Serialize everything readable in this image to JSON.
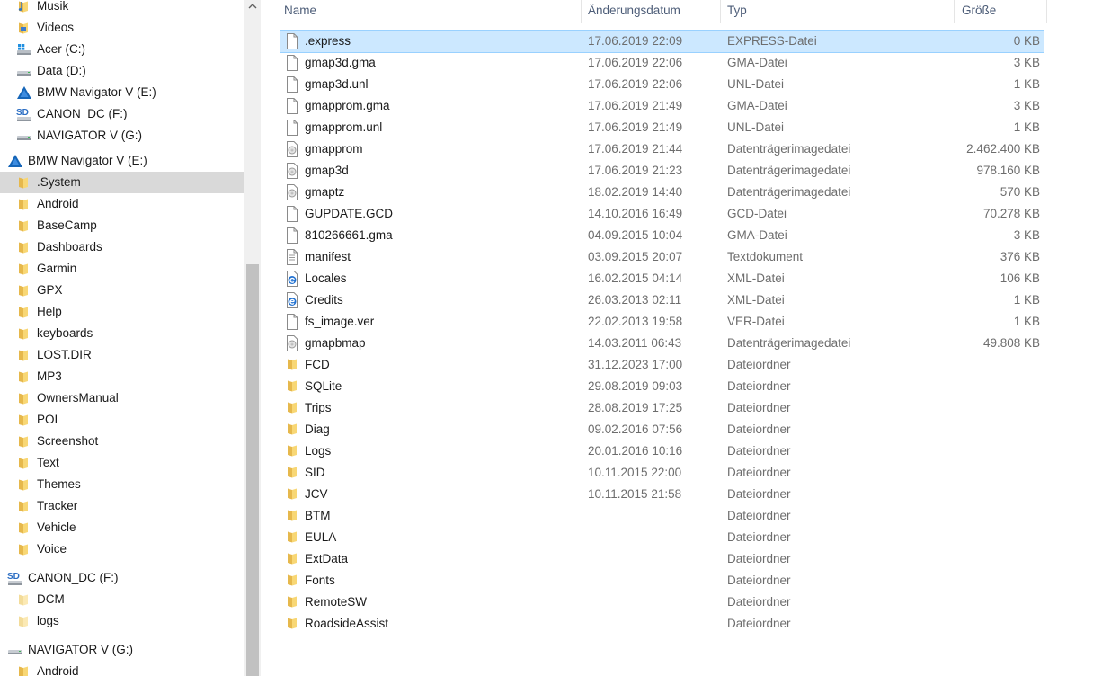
{
  "nav": {
    "items": [
      {
        "label": "Musik",
        "icon": "music-icon",
        "indent": 1
      },
      {
        "label": "Videos",
        "icon": "video-icon",
        "indent": 1
      },
      {
        "label": "Acer (C:)",
        "icon": "drive-windows-icon",
        "indent": 1
      },
      {
        "label": "Data (D:)",
        "icon": "drive-icon",
        "indent": 1
      },
      {
        "label": "BMW Navigator V (E:)",
        "icon": "bmw-drive-icon",
        "indent": 1
      },
      {
        "label": "CANON_DC (F:)",
        "icon": "sd-card-icon",
        "indent": 1
      },
      {
        "label": "NAVIGATOR V (G:)",
        "icon": "drive-icon",
        "indent": 1
      },
      {
        "label": "BMW Navigator V (E:)",
        "icon": "bmw-drive-icon",
        "indent": 0
      },
      {
        "label": ".System",
        "icon": "folder-icon",
        "indent": 1,
        "selected": true
      },
      {
        "label": "Android",
        "icon": "folder-icon",
        "indent": 1
      },
      {
        "label": "BaseCamp",
        "icon": "folder-icon",
        "indent": 1
      },
      {
        "label": "Dashboards",
        "icon": "folder-icon",
        "indent": 1
      },
      {
        "label": "Garmin",
        "icon": "folder-icon",
        "indent": 1
      },
      {
        "label": "GPX",
        "icon": "folder-icon",
        "indent": 1
      },
      {
        "label": "Help",
        "icon": "folder-icon",
        "indent": 1
      },
      {
        "label": "keyboards",
        "icon": "folder-icon",
        "indent": 1
      },
      {
        "label": "LOST.DIR",
        "icon": "folder-icon",
        "indent": 1
      },
      {
        "label": "MP3",
        "icon": "folder-icon",
        "indent": 1
      },
      {
        "label": "OwnersManual",
        "icon": "folder-icon",
        "indent": 1
      },
      {
        "label": "POI",
        "icon": "folder-icon",
        "indent": 1
      },
      {
        "label": "Screenshot",
        "icon": "folder-icon",
        "indent": 1
      },
      {
        "label": "Text",
        "icon": "folder-icon",
        "indent": 1
      },
      {
        "label": "Themes",
        "icon": "folder-icon",
        "indent": 1
      },
      {
        "label": "Tracker",
        "icon": "folder-icon",
        "indent": 1
      },
      {
        "label": "Vehicle",
        "icon": "folder-icon",
        "indent": 1
      },
      {
        "label": "Voice",
        "icon": "folder-icon",
        "indent": 1
      },
      {
        "label": "CANON_DC (F:)",
        "icon": "sd-card-icon",
        "indent": 0
      },
      {
        "label": "DCM",
        "icon": "folder-light-icon",
        "indent": 1
      },
      {
        "label": "logs",
        "icon": "folder-light-icon",
        "indent": 1
      },
      {
        "label": "NAVIGATOR V (G:)",
        "icon": "drive-icon",
        "indent": 0
      },
      {
        "label": "Android",
        "icon": "folder-icon",
        "indent": 1
      }
    ]
  },
  "columns": {
    "name": "Name",
    "date": "Änderungsdatum",
    "type": "Typ",
    "size": "Größe"
  },
  "files": [
    {
      "name": ".express",
      "date": "17.06.2019 22:09",
      "type": "EXPRESS-Datei",
      "size": "0 KB",
      "icon": "file-icon",
      "selected": true
    },
    {
      "name": "gmap3d.gma",
      "date": "17.06.2019 22:06",
      "type": "GMA-Datei",
      "size": "3 KB",
      "icon": "file-icon"
    },
    {
      "name": "gmap3d.unl",
      "date": "17.06.2019 22:06",
      "type": "UNL-Datei",
      "size": "1 KB",
      "icon": "file-icon"
    },
    {
      "name": "gmapprom.gma",
      "date": "17.06.2019 21:49",
      "type": "GMA-Datei",
      "size": "3 KB",
      "icon": "file-icon"
    },
    {
      "name": "gmapprom.unl",
      "date": "17.06.2019 21:49",
      "type": "UNL-Datei",
      "size": "1 KB",
      "icon": "file-icon"
    },
    {
      "name": "gmapprom",
      "date": "17.06.2019 21:44",
      "type": "Datenträgerimagedatei",
      "size": "2.462.400 KB",
      "icon": "disc-image-icon"
    },
    {
      "name": "gmap3d",
      "date": "17.06.2019 21:23",
      "type": "Datenträgerimagedatei",
      "size": "978.160 KB",
      "icon": "disc-image-icon"
    },
    {
      "name": "gmaptz",
      "date": "18.02.2019 14:40",
      "type": "Datenträgerimagedatei",
      "size": "570 KB",
      "icon": "disc-image-icon"
    },
    {
      "name": "GUPDATE.GCD",
      "date": "14.10.2016 16:49",
      "type": "GCD-Datei",
      "size": "70.278 KB",
      "icon": "file-icon"
    },
    {
      "name": "810266661.gma",
      "date": "04.09.2015 10:04",
      "type": "GMA-Datei",
      "size": "3 KB",
      "icon": "file-icon"
    },
    {
      "name": "manifest",
      "date": "03.09.2015 20:07",
      "type": "Textdokument",
      "size": "376 KB",
      "icon": "text-file-icon"
    },
    {
      "name": "Locales",
      "date": "16.02.2015 04:14",
      "type": "XML-Datei",
      "size": "106 KB",
      "icon": "edge-xml-icon"
    },
    {
      "name": "Credits",
      "date": "26.03.2013 02:11",
      "type": "XML-Datei",
      "size": "1 KB",
      "icon": "edge-xml-icon"
    },
    {
      "name": "fs_image.ver",
      "date": "22.02.2013 19:58",
      "type": "VER-Datei",
      "size": "1 KB",
      "icon": "file-icon"
    },
    {
      "name": "gmapbmap",
      "date": "14.03.2011 06:43",
      "type": "Datenträgerimagedatei",
      "size": "49.808 KB",
      "icon": "disc-image-icon"
    },
    {
      "name": "FCD",
      "date": "31.12.2023 17:00",
      "type": "Dateiordner",
      "size": "",
      "icon": "folder-icon"
    },
    {
      "name": "SQLite",
      "date": "29.08.2019 09:03",
      "type": "Dateiordner",
      "size": "",
      "icon": "folder-icon"
    },
    {
      "name": "Trips",
      "date": "28.08.2019 17:25",
      "type": "Dateiordner",
      "size": "",
      "icon": "folder-icon"
    },
    {
      "name": "Diag",
      "date": "09.02.2016 07:56",
      "type": "Dateiordner",
      "size": "",
      "icon": "folder-icon"
    },
    {
      "name": "Logs",
      "date": "20.01.2016 10:16",
      "type": "Dateiordner",
      "size": "",
      "icon": "folder-icon"
    },
    {
      "name": "SID",
      "date": "10.11.2015 22:00",
      "type": "Dateiordner",
      "size": "",
      "icon": "folder-icon"
    },
    {
      "name": "JCV",
      "date": "10.11.2015 21:58",
      "type": "Dateiordner",
      "size": "",
      "icon": "folder-icon"
    },
    {
      "name": "BTM",
      "date": "",
      "type": "Dateiordner",
      "size": "",
      "icon": "folder-icon"
    },
    {
      "name": "EULA",
      "date": "",
      "type": "Dateiordner",
      "size": "",
      "icon": "folder-icon"
    },
    {
      "name": "ExtData",
      "date": "",
      "type": "Dateiordner",
      "size": "",
      "icon": "folder-icon"
    },
    {
      "name": "Fonts",
      "date": "",
      "type": "Dateiordner",
      "size": "",
      "icon": "folder-icon"
    },
    {
      "name": "RemoteSW",
      "date": "",
      "type": "Dateiordner",
      "size": "",
      "icon": "folder-icon"
    },
    {
      "name": "RoadsideAssist",
      "date": "",
      "type": "Dateiordner",
      "size": "",
      "icon": "folder-icon"
    }
  ],
  "colors": {
    "selection": "#cce8ff",
    "selection_border": "#99d1ff",
    "nav_selection": "#d9d9d9",
    "folder": "#f8d775",
    "header_text": "#4d5d78",
    "secondary_text": "#6d6d6d"
  }
}
